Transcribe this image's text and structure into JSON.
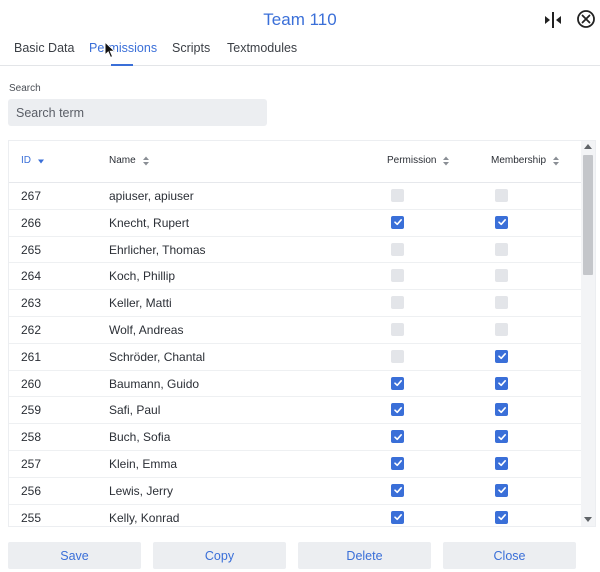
{
  "window": {
    "title": "Team 110"
  },
  "tabs": [
    {
      "label": "Basic Data",
      "active": false
    },
    {
      "label": "Permissions",
      "active": true
    },
    {
      "label": "Scripts",
      "active": false
    },
    {
      "label": "Textmodules",
      "active": false
    }
  ],
  "search": {
    "label": "Search",
    "placeholder": "Search term",
    "value": ""
  },
  "table": {
    "columns": [
      {
        "label": "ID",
        "sort": "descending"
      },
      {
        "label": "Name",
        "sort": "none"
      },
      {
        "label": "Permission",
        "sort": "none"
      },
      {
        "label": "Membership",
        "sort": "none"
      }
    ],
    "rows": [
      {
        "id": "267",
        "name": "apiuser, apiuser",
        "permission": false,
        "membership": false
      },
      {
        "id": "266",
        "name": "Knecht, Rupert",
        "permission": true,
        "membership": true
      },
      {
        "id": "265",
        "name": "Ehrlicher, Thomas",
        "permission": false,
        "membership": false
      },
      {
        "id": "264",
        "name": "Koch, Phillip",
        "permission": false,
        "membership": false
      },
      {
        "id": "263",
        "name": "Keller, Matti",
        "permission": false,
        "membership": false
      },
      {
        "id": "262",
        "name": "Wolf, Andreas",
        "permission": false,
        "membership": false
      },
      {
        "id": "261",
        "name": "Schröder, Chantal",
        "permission": false,
        "membership": true
      },
      {
        "id": "260",
        "name": "Baumann, Guido",
        "permission": true,
        "membership": true
      },
      {
        "id": "259",
        "name": "Safi, Paul",
        "permission": true,
        "membership": true
      },
      {
        "id": "258",
        "name": "Buch, Sofia",
        "permission": true,
        "membership": true
      },
      {
        "id": "257",
        "name": "Klein, Emma",
        "permission": true,
        "membership": true
      },
      {
        "id": "256",
        "name": "Lewis, Jerry",
        "permission": true,
        "membership": true
      },
      {
        "id": "255",
        "name": "Kelly, Konrad",
        "permission": true,
        "membership": true
      }
    ]
  },
  "footer": {
    "save": "Save",
    "copy": "Copy",
    "delete": "Delete",
    "close": "Close"
  },
  "icons": {
    "split": "split-view-icon",
    "close": "close-circle-icon"
  },
  "colors": {
    "accent": "#3a6fd8",
    "unchecked": "#e3e5e9",
    "button_bg": "#eceef1"
  }
}
